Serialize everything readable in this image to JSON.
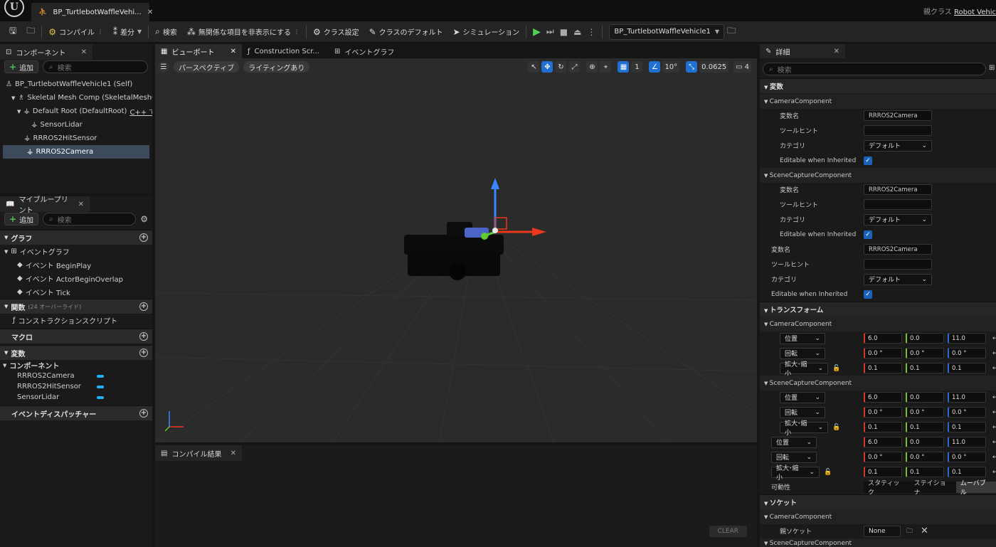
{
  "window": {
    "doc_tab_label": "BP_TurtlebotWaffleVehi...",
    "parent_class_label": "親クラス",
    "parent_class_name": "Robot Vehic"
  },
  "toolbar": {
    "compile": "コンパイル",
    "diff": "差分",
    "search": "検索",
    "hide_unrelated": "無関係な項目を非表示にする",
    "class_settings": "クラス設定",
    "class_defaults": "クラスのデフォルト",
    "simulation": "シミュレーション",
    "debug_object": "BP_TurtlebotWaffleVehicle1"
  },
  "components_panel": {
    "tab_label": "コンポーネント",
    "add_label": "追加",
    "search_placeholder": "検索",
    "tree": [
      {
        "label": "BP_TurtlebotWaffleVehicle1 (Self)"
      },
      {
        "label": "Skeletal Mesh Comp (SkeletalMeshCo"
      },
      {
        "label": "Default Root (DefaultRoot)",
        "link": "C++ で編"
      },
      {
        "label": "SensorLidar"
      },
      {
        "label": "RRROS2HitSensor"
      },
      {
        "label": "RRROS2Camera"
      }
    ]
  },
  "my_blueprint": {
    "tab_label": "マイブループリント",
    "add_label": "追加",
    "search_placeholder": "検索",
    "graph_label": "グラフ",
    "event_graph_label": "イベントグラフ",
    "events": [
      "イベント BeginPlay",
      "イベント ActorBeginOverlap",
      "イベント Tick"
    ],
    "functions_label": "関数",
    "functions_override": "(24 オーバーライド)",
    "construction_script": "コンストラクションスクリプト",
    "macros_label": "マクロ",
    "variables_label": "変数",
    "components_label": "コンポーネント",
    "component_vars": [
      "RRROS2Camera",
      "RRROS2HitSensor",
      "SensorLidar"
    ],
    "dispatchers_label": "イベントディスパッチャー"
  },
  "editor_tabs": {
    "viewport": "ビューポート",
    "construction": "Construction Scr...",
    "event_graph": "イベントグラフ"
  },
  "viewport": {
    "perspective": "パースペクティブ",
    "lighting": "ライティングあり",
    "grid_size": "1",
    "rotation_snap": "10°",
    "scale_snap": "0.0625",
    "camera_speed": "4"
  },
  "compile_panel": {
    "tab_label": "コンパイル結果",
    "clear": "CLEAR"
  },
  "details": {
    "tab_label": "詳細",
    "search_placeholder": "検索",
    "variables_cat": "変数",
    "camera_component": "CameraComponent",
    "scene_capture_component": "SceneCaptureComponent",
    "var_name_label": "変数名",
    "tooltip_label": "ツールヒント",
    "category_label": "カテゴリ",
    "editable_label": "Editable when Inherited",
    "var_name_value": "RRROS2Camera",
    "category_value": "デフォルト",
    "transform_cat": "トランスフォーム",
    "location_label": "位置",
    "rotation_label": "回転",
    "scale_label": "拡大･縮小",
    "location": [
      "6.0",
      "0.0",
      "11.0"
    ],
    "rotation": [
      "0.0 °",
      "0.0 °",
      "0.0 °"
    ],
    "scale": [
      "0.1",
      "0.1",
      "0.1"
    ],
    "mobility_label": "可動性",
    "mobility": [
      "スタティック",
      "ステイショナ",
      "ムーバブル"
    ],
    "socket_cat": "ソケット",
    "parent_socket_label": "親ソケット",
    "parent_socket_value": "None",
    "next_cut": "SceneCaptureComponent"
  }
}
